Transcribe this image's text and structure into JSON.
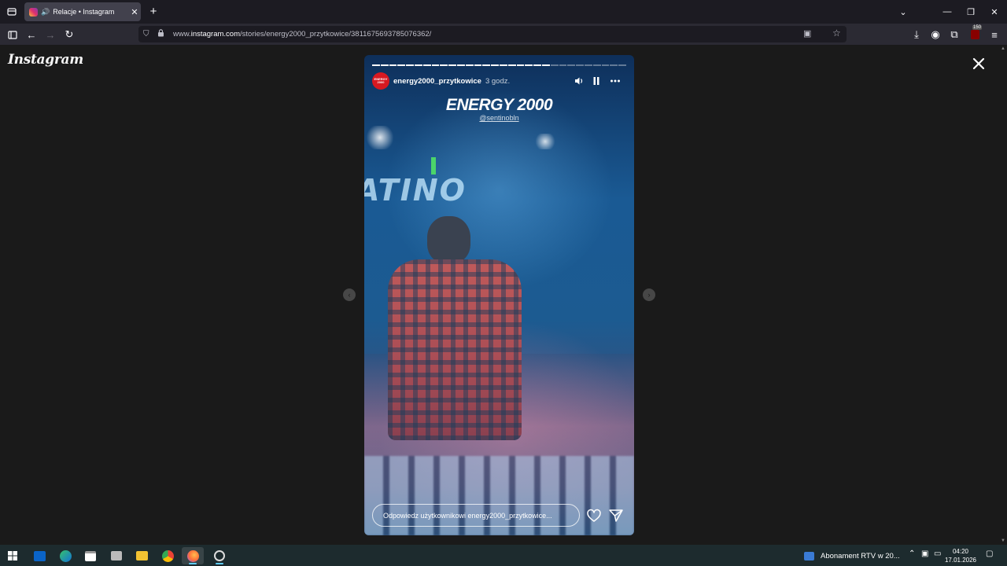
{
  "browser": {
    "tab_title": "Relacje • Instagram",
    "url_prefix": "www.",
    "url_domain": "instagram.com",
    "url_path": "/stories/energy2000_przytkowice/3811675693785076362/",
    "extension_badge": "150"
  },
  "page": {
    "logo_text": "Instagram"
  },
  "story": {
    "username": "energy2000_przytkowice",
    "time_ago": "3 godz.",
    "avatar_text": "ENERGY 2000",
    "brand_text": "ENERGY 2000",
    "brand_handle": "@sentinobln",
    "led_text": "ATINO",
    "reply_placeholder": "Odpowiedz użytkownikowi energy2000_przytkowice...",
    "progress_total": 30,
    "progress_done": 21
  },
  "taskbar": {
    "news_text": "Abonament RTV w 20...",
    "time": "04:20",
    "date": "17.01.2026"
  },
  "colors": {
    "browser_bg": "#1c1b22",
    "page_bg": "#1a1a1a",
    "taskbar_bg": "#1d2b2e",
    "brand_red": "#d71921"
  }
}
